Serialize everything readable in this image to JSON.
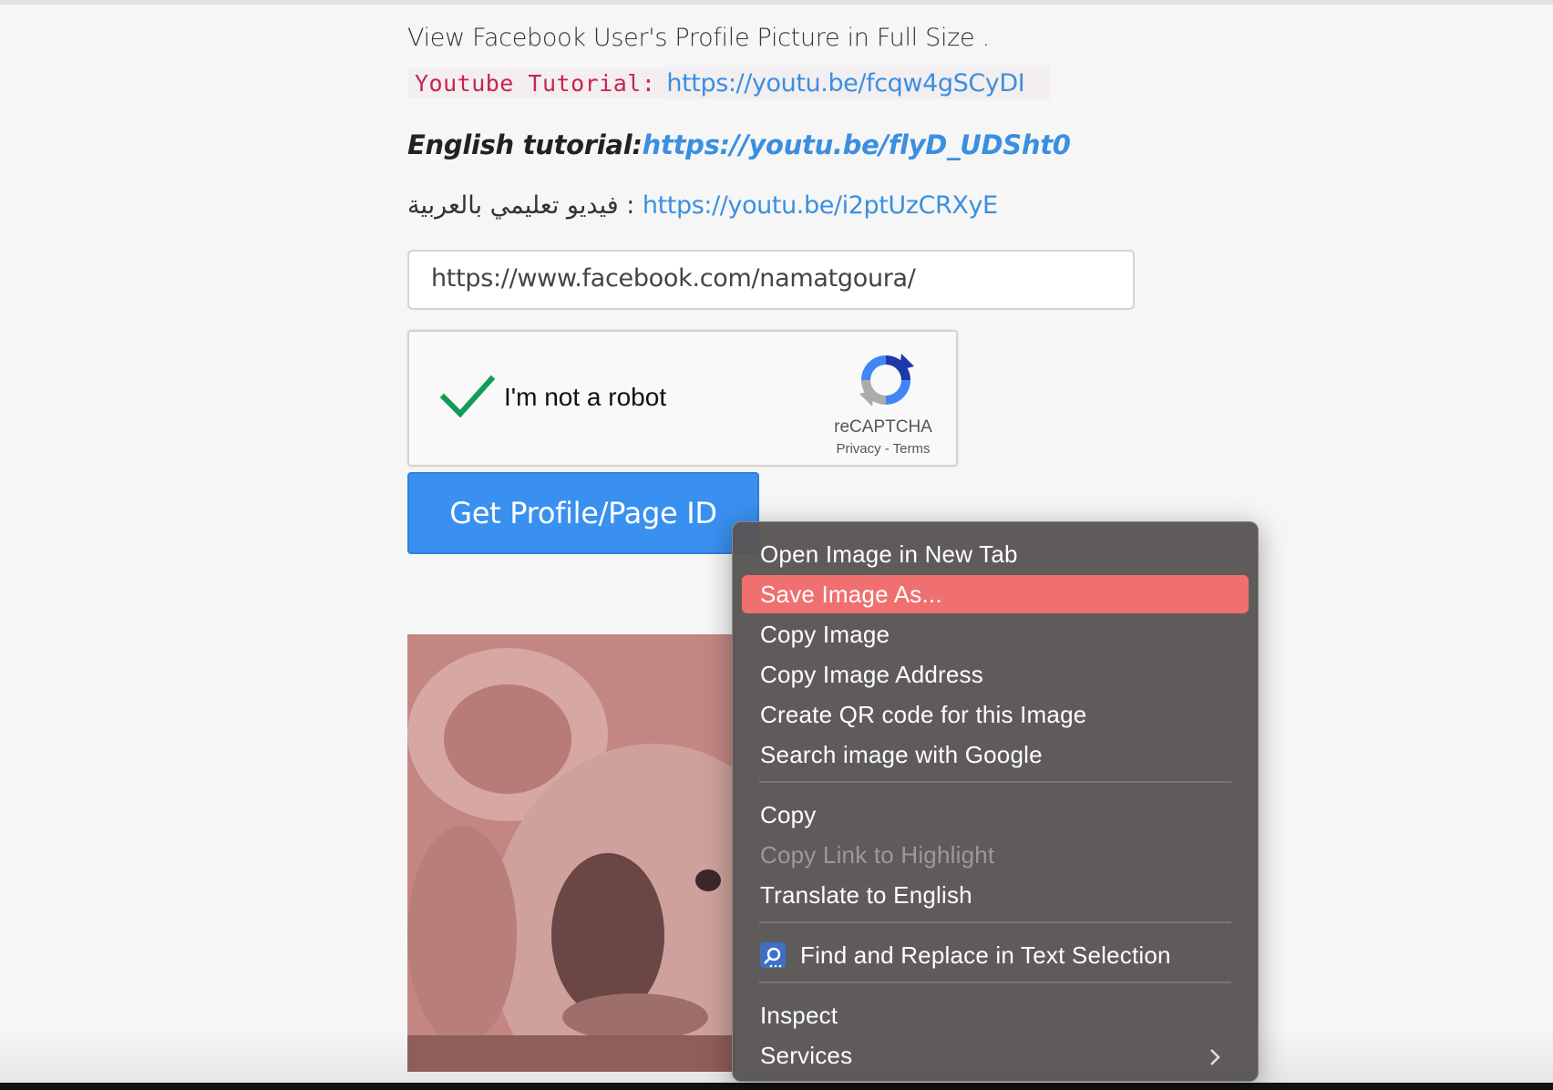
{
  "page": {
    "intro_text": "View Facebook User's Profile Picture in Full Size .",
    "youtube_label": "Youtube Tutorial:",
    "youtube_link": "https://youtu.be/fcqw4gSCyDI",
    "english_label": "English tutorial:",
    "english_link": "https://youtu.be/flyD_UDSht0",
    "arabic_label": "فيديو تعليمي بالعربية :",
    "arabic_link": "https://youtu.be/i2ptUzCRXyE",
    "url_value": "https://www.facebook.com/namatgoura/",
    "captcha_label": "I'm not a robot",
    "captcha_brand": "reCAPTCHA",
    "captcha_links": "Privacy - Terms",
    "button_label": "Get Profile/Page ID"
  },
  "context_menu": {
    "items": [
      {
        "label": "Open Image in New Tab"
      },
      {
        "label": "Save Image As..."
      },
      {
        "label": "Copy Image"
      },
      {
        "label": "Copy Image Address"
      },
      {
        "label": "Create QR code for this Image"
      },
      {
        "label": "Search image with Google"
      },
      {
        "label": "Copy"
      },
      {
        "label": "Copy Link to Highlight"
      },
      {
        "label": "Translate to English"
      },
      {
        "label": "Find and Replace in Text Selection",
        "icon": "find-replace-icon"
      },
      {
        "label": "Inspect"
      },
      {
        "label": "Services",
        "icon": "chevron-right-icon"
      }
    ],
    "highlight_color": "#f07070"
  },
  "colors": {
    "link": "#3a8fe0",
    "button": "#3a90f0",
    "code": "#c7254e",
    "checkmark": "#0f9d58"
  }
}
